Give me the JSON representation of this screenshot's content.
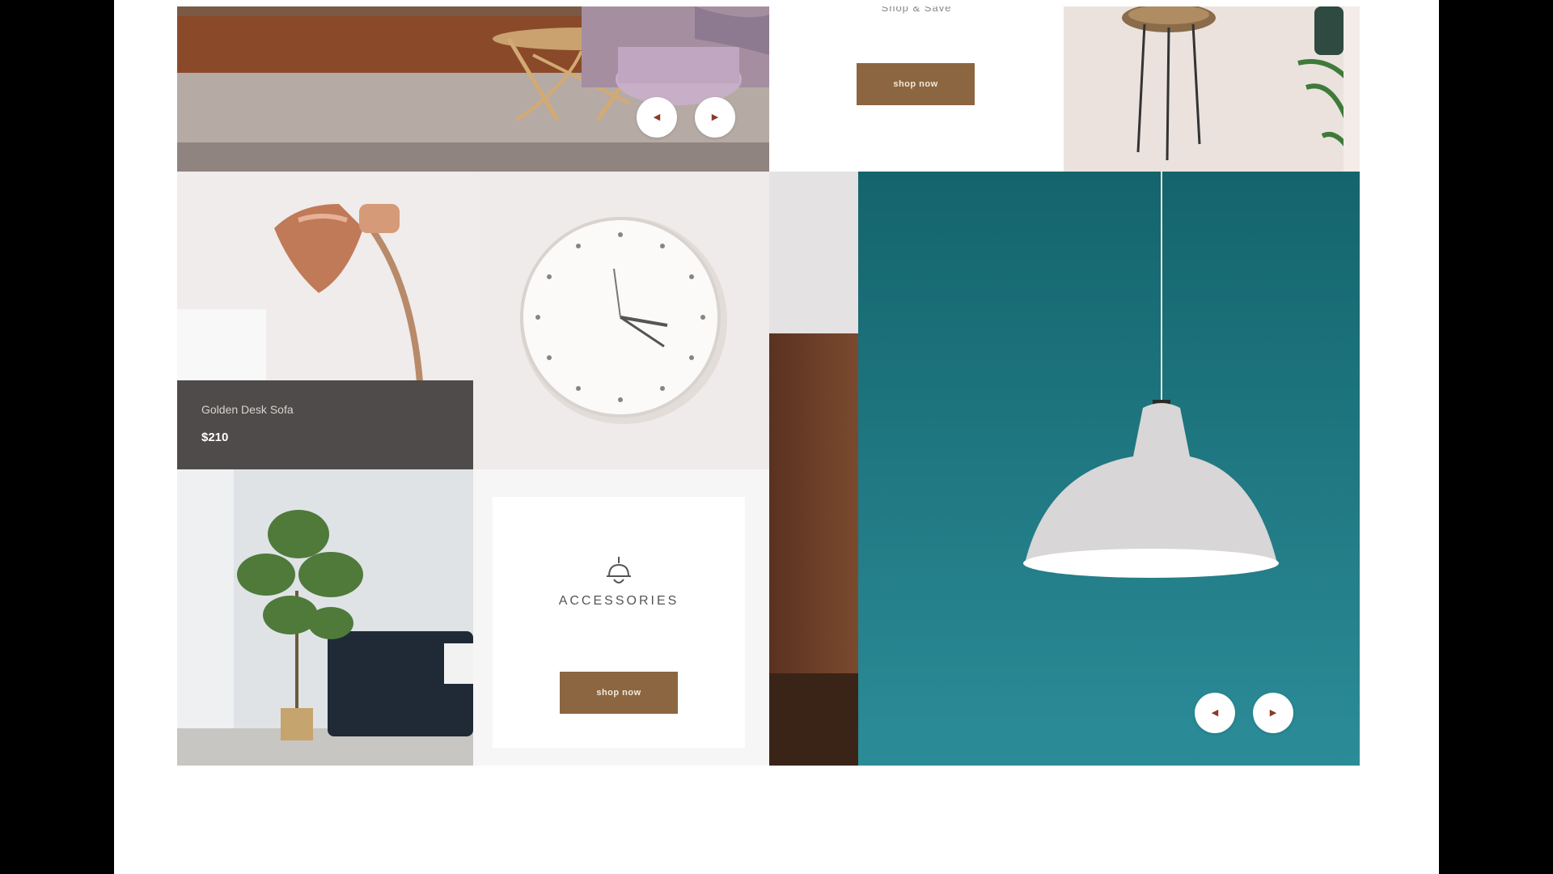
{
  "header": {
    "cutoff_text": "Shop & Save"
  },
  "hero_slider": {
    "prev_icon": "chevron-left-icon",
    "next_icon": "chevron-right-icon"
  },
  "promo_cta": {
    "button_label": "shop now"
  },
  "product_card": {
    "name": "Golden Desk Sofa",
    "price": "$210"
  },
  "accessories": {
    "icon": "pendant-lamp-icon",
    "title": "ACCESSORIES",
    "button_label": "shop now"
  },
  "pendant_slider": {
    "prev_icon": "chevron-left-icon",
    "next_icon": "chevron-right-icon"
  },
  "colors": {
    "accent": "#8b6640",
    "teal": "#1b6a74",
    "caption_bg": "#4e4b4a"
  }
}
